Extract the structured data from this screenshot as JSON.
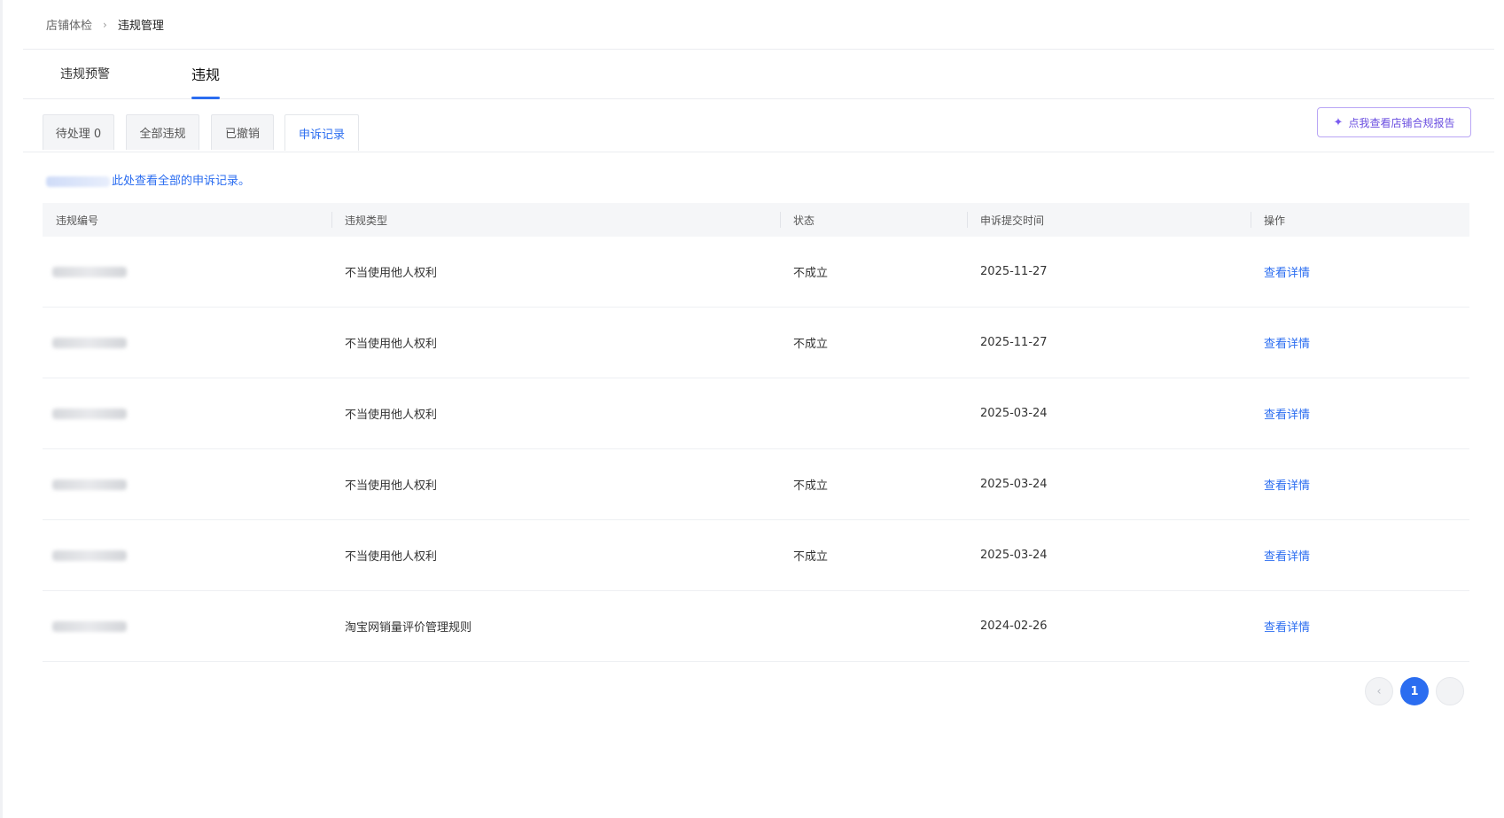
{
  "breadcrumb": {
    "parent": "店铺体检",
    "separator": "›",
    "current": "违规管理"
  },
  "main_tabs": [
    {
      "label": "违规预警"
    },
    {
      "label": "违规"
    }
  ],
  "sub_tabs": [
    {
      "label": "待处理 0"
    },
    {
      "label": "全部违规"
    },
    {
      "label": "已撤销"
    },
    {
      "label": "申诉记录"
    }
  ],
  "report_button": {
    "icon": "sparkle-icon",
    "label": "点我查看店铺合规报告"
  },
  "notice": {
    "text": "此处查看全部的申诉记录。"
  },
  "table": {
    "headers": [
      "违规编号",
      "违规类型",
      "状态",
      "申诉提交时间",
      "操作"
    ],
    "rows": [
      {
        "type": "不当使用他人权利",
        "status": "不成立",
        "date": "2025-11-27",
        "action": "查看详情"
      },
      {
        "type": "不当使用他人权利",
        "status": "不成立",
        "date": "2025-11-27",
        "action": "查看详情"
      },
      {
        "type": "不当使用他人权利",
        "status": "",
        "date": "2025-03-24",
        "action": "查看详情"
      },
      {
        "type": "不当使用他人权利",
        "status": "不成立",
        "date": "2025-03-24",
        "action": "查看详情"
      },
      {
        "type": "不当使用他人权利",
        "status": "不成立",
        "date": "2025-03-24",
        "action": "查看详情"
      },
      {
        "type": "淘宝网销量评价管理规则",
        "status": "",
        "date": "2024-02-26",
        "action": "查看详情"
      }
    ]
  },
  "pagination": {
    "prev": "‹",
    "current": "1",
    "next": ""
  },
  "colors": {
    "accent": "#2b6df0",
    "report_border": "#b9a6f5"
  }
}
